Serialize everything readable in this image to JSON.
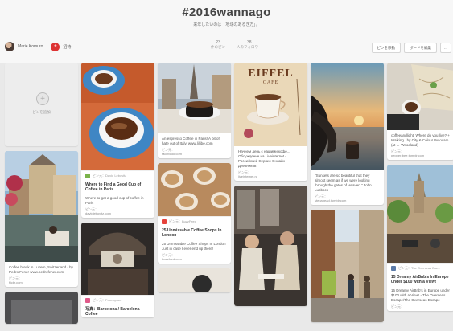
{
  "board": {
    "title": "#2016wannago",
    "subtitle": "来年したいのは「地球のあるき方」。",
    "owner": "Marie Komuro",
    "invite_badge": "+",
    "invite_label": "招待",
    "stats": [
      {
        "count": "23",
        "label": "件のピン"
      },
      {
        "count": "38",
        "label": "人のフォロワー"
      }
    ],
    "actions": [
      "ピンを移動",
      "ボードを編集",
      "…"
    ]
  },
  "add_pin": {
    "icon": "+",
    "label": "ピンを追加"
  },
  "pins": {
    "coffee_paris": {
      "attribution": "ピン元：David Lebovitz",
      "title": "Where to Find a Good Cup of Coffee in Paris",
      "desc": "Where to get a good cup of coffee in Paris",
      "src_label": "ピン元：",
      "src": "davidlebovitz.com"
    },
    "lucerne": {
      "desc": "Coffee break in Luzern, Switzerland / by Pedro Fener www.pedrofener.com",
      "src_label": "ピン元：",
      "src": "flickr.com"
    },
    "paris_coffee": {
      "desc": "An espresso Coffee in Paris! A bit of hate out of Italy. www.lillibe.com",
      "src_label": "ピン元：",
      "src": "facebook.com"
    },
    "london": {
      "attribution": "ピン元：BuzzFeed",
      "title": "25 Unmissable Coffee Shops In London",
      "desc": "25 Unmissable Coffee Shops In London Just in case I ever end up there!",
      "src_label": "ピン元：",
      "src": "buzzfeed.com"
    },
    "eiffel_cafe": {
      "desc": "Начнем день с нашими кофе... Обсуждение на Liveinternet - Российский Сервис Онлайн-Дневников",
      "src_label": "ピン元：",
      "src": "liveinternet.ru",
      "sign1": "EIFFEL",
      "sign2": "CAFE"
    },
    "sunset": {
      "desc": "\"Sunsets are so beautiful that they almost seem as if we were looking through the gates of Heaven.\" John Lubbock",
      "src_label": "ピン元：",
      "src": "stepahead.tumblr.com"
    },
    "coffee_map": {
      "desc": "coffeeandlight: Where do you live? + Walking.. by City & Colour #vsocam (at ← Woodland)",
      "src_label": "ピン元：",
      "src": "pepper-bee.tumblr.com"
    },
    "europe": {
      "attribution": "ピン元：The Overseas Esc...",
      "title": "15 Dreamy AirBnb's In Europe under $100 with a View!",
      "desc": "15 Dreamy AirBnb's in Europe under $100 with a View! - The Overseas Escape/The Overseas Escape",
      "src_label": "ピン元：",
      "src": ""
    },
    "foursquare": {
      "attribution": "ピン元：Foursquare",
      "title": "写真：Barcelona / Barcelona Coffee"
    }
  },
  "colors": {
    "pinterest_red": "#cb2027",
    "bg": "#e9e9e9"
  }
}
